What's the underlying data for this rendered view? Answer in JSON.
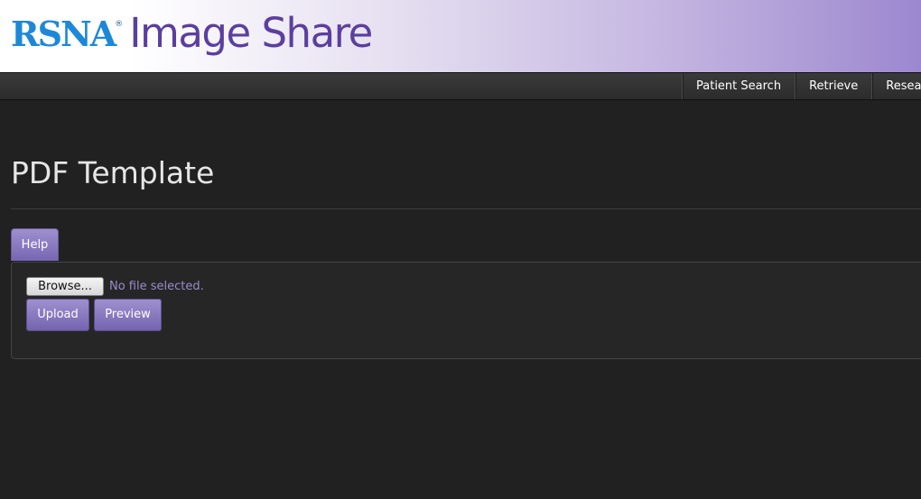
{
  "header": {
    "logo_text": "RSNA",
    "logo_mark": "®",
    "app_title": "Image Share"
  },
  "nav": {
    "items": [
      {
        "label": "Patient Search"
      },
      {
        "label": "Retrieve"
      },
      {
        "label": "Resea"
      }
    ]
  },
  "main": {
    "page_title": "PDF Template",
    "tabs": [
      {
        "label": "Help"
      }
    ],
    "form": {
      "browse_label": "Browse...",
      "file_status": "No file selected.",
      "upload_label": "Upload",
      "preview_label": "Preview"
    }
  },
  "colors": {
    "background": "#212121",
    "accent": "#7f70bb",
    "logo_blue": "#1e88d8",
    "title_purple": "#5b3f9e"
  }
}
